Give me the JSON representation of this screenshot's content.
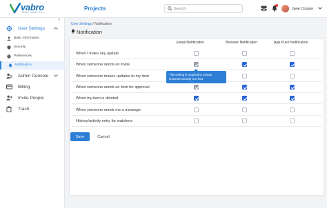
{
  "header": {
    "logo_text": "vabro",
    "logo_tagline": "Make Work Fun",
    "app_title": "Projects",
    "search_placeholder": "Search",
    "user_name": "Jane Cooper",
    "colors": {
      "accent": "#2d7fd6",
      "checkbox": "#2563d9",
      "notification_dot": "#e53935"
    }
  },
  "sidebar": {
    "collapse_glyph": "«",
    "user_settings": {
      "label": "User Settings",
      "icon": "gear-icon",
      "sub_items": [
        {
          "label": "Basic Information",
          "icon": "person-icon"
        },
        {
          "label": "Security",
          "icon": "shield-icon"
        },
        {
          "label": "Preferences",
          "icon": "palette-icon"
        },
        {
          "label": "Notification",
          "icon": "bell-icon"
        }
      ]
    },
    "items": [
      {
        "label": "Admin Console",
        "icon": "admin-icon"
      },
      {
        "label": "Billing",
        "icon": "card-icon"
      },
      {
        "label": "Invite People",
        "icon": "add-person-icon"
      },
      {
        "label": "Trash",
        "icon": "trash-icon"
      }
    ]
  },
  "breadcrumb": {
    "parent": "User Settings",
    "separator": " / ",
    "current": "Notification"
  },
  "page": {
    "title": "Notification"
  },
  "table": {
    "columns": [
      "Email Notification",
      "Browser Notification",
      "App Push Notification"
    ],
    "rows": [
      {
        "label": "When I make any update",
        "email": false,
        "browser": false,
        "push": false
      },
      {
        "label": "When someone sends an invite",
        "email": "disabled-checked",
        "browser": true,
        "push": true
      },
      {
        "label": "When someone makes updates to my item",
        "email": false,
        "browser": false,
        "push": false
      },
      {
        "label": "When someone sends an item for approval",
        "email": "disabled-checked",
        "browser": true,
        "push": true
      },
      {
        "label": "When my item is deleted",
        "email": true,
        "browser": true,
        "push": true
      },
      {
        "label": "When someone sends me a message",
        "email": false,
        "browser": false,
        "push": false
      },
      {
        "label": "History/activity entry for watchers",
        "email": false,
        "browser": false,
        "push": false
      }
    ]
  },
  "tooltip": {
    "text": "This setting is required to ensure important activity isn't lost."
  },
  "actions": {
    "save": "Save",
    "cancel": "Cancel"
  }
}
